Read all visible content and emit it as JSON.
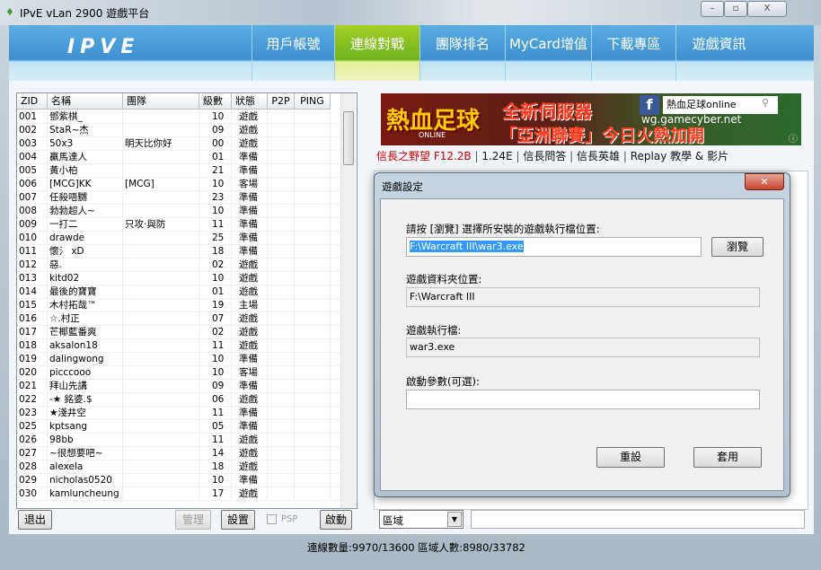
{
  "window": {
    "title": "IPvE vLan 2900 遊戲平台",
    "minimize": "–",
    "maximize": "▫",
    "close": "X"
  },
  "nav": {
    "logo": "IPVE",
    "tabs": [
      "用戶帳號",
      "連線對戰",
      "團隊排名",
      "MyCard增值",
      "下載專區",
      "遊戲資訊"
    ],
    "active": 1
  },
  "list": {
    "columns": [
      "ZID",
      "名稱",
      "團隊",
      "級數",
      "狀態",
      "P2P",
      "PING"
    ],
    "rows": [
      [
        "001",
        "鄧紫棋_",
        "",
        "10",
        "遊戲"
      ],
      [
        "002",
        "StaR~杰",
        "",
        "09",
        "遊戲"
      ],
      [
        "003",
        "50x3",
        "明天比你好",
        "00",
        "遊戲"
      ],
      [
        "004",
        "贏馬達人",
        "",
        "01",
        "準備"
      ],
      [
        "005",
        "黃小柏",
        "",
        "21",
        "準備"
      ],
      [
        "006",
        "[MCG]KK",
        "[MCG]",
        "10",
        "客場"
      ],
      [
        "007",
        "任殺唔嬲",
        "",
        "23",
        "準備"
      ],
      [
        "008",
        "勃勃超人~",
        "",
        "10",
        "準備"
      ],
      [
        "009",
        "一打二",
        "只攻‧與防",
        "11",
        "準備"
      ],
      [
        "010",
        "drawde",
        "",
        "25",
        "準備"
      ],
      [
        "011",
        "懷氵 xD",
        "",
        "18",
        "準備"
      ],
      [
        "012",
        "        惡.",
        "",
        "02",
        "遊戲"
      ],
      [
        "013",
        "kitd02",
        "",
        "10",
        "遊戲"
      ],
      [
        "014",
        "最後的寶寶",
        "",
        "01",
        "遊戲"
      ],
      [
        "015",
        "木村拓哉™",
        "",
        "19",
        "主場"
      ],
      [
        "016",
        "☆.村正",
        "",
        "07",
        "遊戲"
      ],
      [
        "017",
        "芒椰藍番爽",
        "",
        "02",
        "遊戲"
      ],
      [
        "018",
        "aksalon18",
        "",
        "11",
        "遊戲"
      ],
      [
        "019",
        "dalingwong",
        "",
        "10",
        "準備"
      ],
      [
        "020",
        "picccooo",
        "",
        "10",
        "客場"
      ],
      [
        "021",
        "拜山先講",
        "",
        "09",
        "準備"
      ],
      [
        "022",
        "-★   銘婆.$",
        "",
        "06",
        "遊戲"
      ],
      [
        "023",
        "★淺井空",
        "",
        "11",
        "準備"
      ],
      [
        "025",
        "kptsang",
        "",
        "05",
        "準備"
      ],
      [
        "026",
        "98bb",
        "",
        "11",
        "遊戲"
      ],
      [
        "027",
        "~很想要吧~",
        "",
        "14",
        "遊戲"
      ],
      [
        "028",
        "alexela",
        "",
        "18",
        "遊戲"
      ],
      [
        "029",
        "nicholas0520",
        "",
        "10",
        "準備"
      ],
      [
        "030",
        "kamluncheung",
        "",
        "17",
        "遊戲"
      ]
    ]
  },
  "left_buttons": {
    "exit": "退出",
    "manage": "管理",
    "settings": "設置",
    "psp": "PSP",
    "start": "啟動"
  },
  "banner": {
    "logo_text": "熱血足球",
    "logo_sub": "ONLINE",
    "headline1": "全新伺服器",
    "headline2": "「亞洲聯賽」今日火熱加開",
    "search_text": "熱血足球online",
    "site": "wg.gamecyber.net"
  },
  "links": [
    {
      "text": "信長之野望 F12.2B",
      "color": "#d00000"
    },
    {
      "text": "1.24E"
    },
    {
      "text": "信長問答"
    },
    {
      "text": "信長英雄"
    },
    {
      "text": "Replay 教學 & 影片"
    }
  ],
  "dialog": {
    "title": "遊戲設定",
    "label_exe_path": "請按 [瀏覽] 選擇所安裝的遊戲執行檔位置:",
    "exe_path": "F:\\Warcraft III\\war3.exe",
    "browse": "瀏覽",
    "label_folder": "遊戲資料夾位置:",
    "folder": "F:\\Warcraft III",
    "label_exe": "遊戲執行檔:",
    "exe": "war3.exe",
    "label_args": "啟動參數(可選):",
    "args": "",
    "reset": "重設",
    "apply": "套用"
  },
  "chat": {
    "region": "區域",
    "input": ""
  },
  "status": "連線數量:9970/13600    區域人數:8980/33782"
}
